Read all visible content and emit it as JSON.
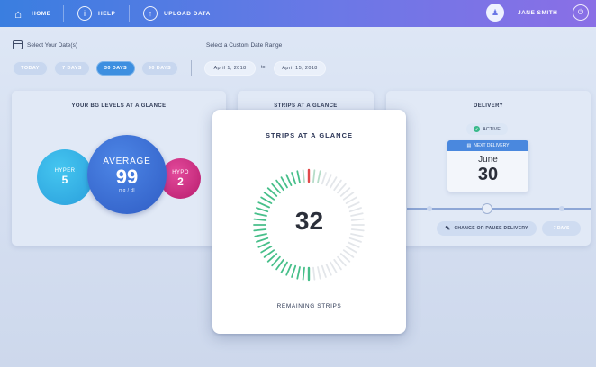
{
  "nav": {
    "home_label": "HOME",
    "help_label": "HELP",
    "upload_label": "UPLOAD DATA",
    "user_name": "JANE SMITH"
  },
  "filters": {
    "date_label": "Select Your Date(s)",
    "range_label": "Select a Custom Date Range",
    "pills": [
      "TODAY",
      "7 DAYS",
      "30 DAYS",
      "90 DAYS"
    ],
    "active_pill": "30 DAYS",
    "from_date": "April 1, 2018",
    "to_label": "to",
    "to_date": "April 15, 2018"
  },
  "bg_card": {
    "title": "YOUR BG LEVELS AT A GLANCE",
    "hyper_label": "HYPER",
    "hyper_value": "5",
    "average_label": "AVERAGE",
    "average_value": "99",
    "average_unit": "mg / dl",
    "hypo_label": "HYPO",
    "hypo_value": "2"
  },
  "strips_bg_card": {
    "title": "STRIPS AT A GLANCE"
  },
  "strips": {
    "title": "STRIPS AT A GLANCE",
    "count": "32",
    "subtitle": "REMAINING STRIPS",
    "remaining_fraction": 0.55
  },
  "delivery": {
    "title": "DELIVERY",
    "status": "ACTIVE",
    "next_label": "NEXT DELIVERY",
    "month": "June",
    "day": "30",
    "change_label": "CHANGE OR PAUSE DELIVERY",
    "days_label": "7 DAYS"
  },
  "colors": {
    "accent": "#3d8fe0",
    "hyper": "#2fb2e6",
    "average": "#3a6fd8",
    "hypo": "#d02a83",
    "gauge_green": "#47bf8a",
    "gauge_red": "#e04a4a",
    "gauge_inactive": "#e3e6ea"
  },
  "icons": [
    "home-icon",
    "help-icon",
    "upload-icon",
    "user-icon",
    "logout-icon",
    "calendar-icon",
    "check-icon",
    "pencil-icon"
  ]
}
